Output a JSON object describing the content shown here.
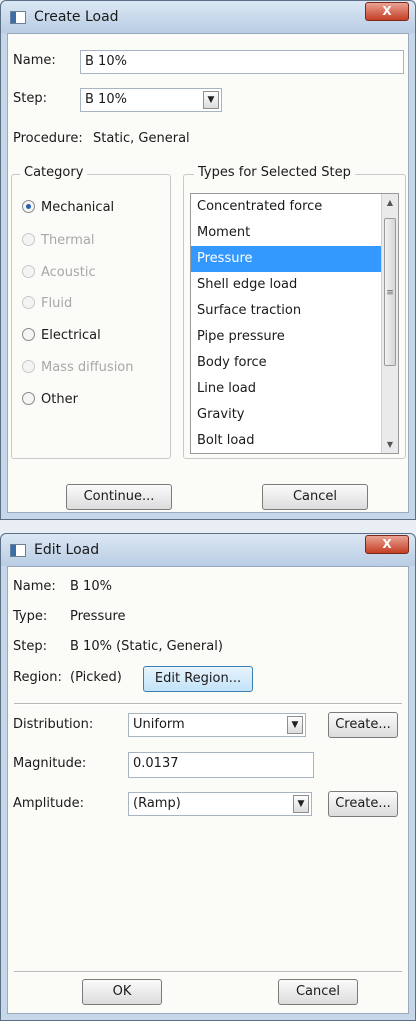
{
  "create_load": {
    "title": "Create Load",
    "close_symbol": "X",
    "name_label": "Name:",
    "name_value": "B 10%",
    "step_label": "Step:",
    "step_value": "B 10%",
    "procedure_label": "Procedure:",
    "procedure_value": "Static, General",
    "category": {
      "title": "Category",
      "options": [
        {
          "label": "Mechanical",
          "checked": true,
          "enabled": true
        },
        {
          "label": "Thermal",
          "checked": false,
          "enabled": false
        },
        {
          "label": "Acoustic",
          "checked": false,
          "enabled": false
        },
        {
          "label": "Fluid",
          "checked": false,
          "enabled": false
        },
        {
          "label": "Electrical",
          "checked": false,
          "enabled": true
        },
        {
          "label": "Mass diffusion",
          "checked": false,
          "enabled": false
        },
        {
          "label": "Other",
          "checked": false,
          "enabled": true
        }
      ]
    },
    "types": {
      "title": "Types for Selected Step",
      "items": [
        "Concentrated force",
        "Moment",
        "Pressure",
        "Shell edge load",
        "Surface traction",
        "Pipe pressure",
        "Body force",
        "Line load",
        "Gravity",
        "Bolt load"
      ],
      "selected": "Pressure"
    },
    "continue_label": "Continue...",
    "cancel_label": "Cancel"
  },
  "edit_load": {
    "title": "Edit Load",
    "close_symbol": "X",
    "name_label": "Name:",
    "name_value": "B 10%",
    "type_label": "Type:",
    "type_value": "Pressure",
    "step_label": "Step:",
    "step_value": "B 10% (Static, General)",
    "region_label": "Region:",
    "region_value": "(Picked)",
    "edit_region_label": "Edit Region...",
    "distribution_label": "Distribution:",
    "distribution_value": "Uniform",
    "create_label": "Create...",
    "magnitude_label": "Magnitude:",
    "magnitude_value": "0.0137",
    "amplitude_label": "Amplitude:",
    "amplitude_value": "(Ramp)",
    "ok_label": "OK",
    "cancel_label": "Cancel"
  }
}
